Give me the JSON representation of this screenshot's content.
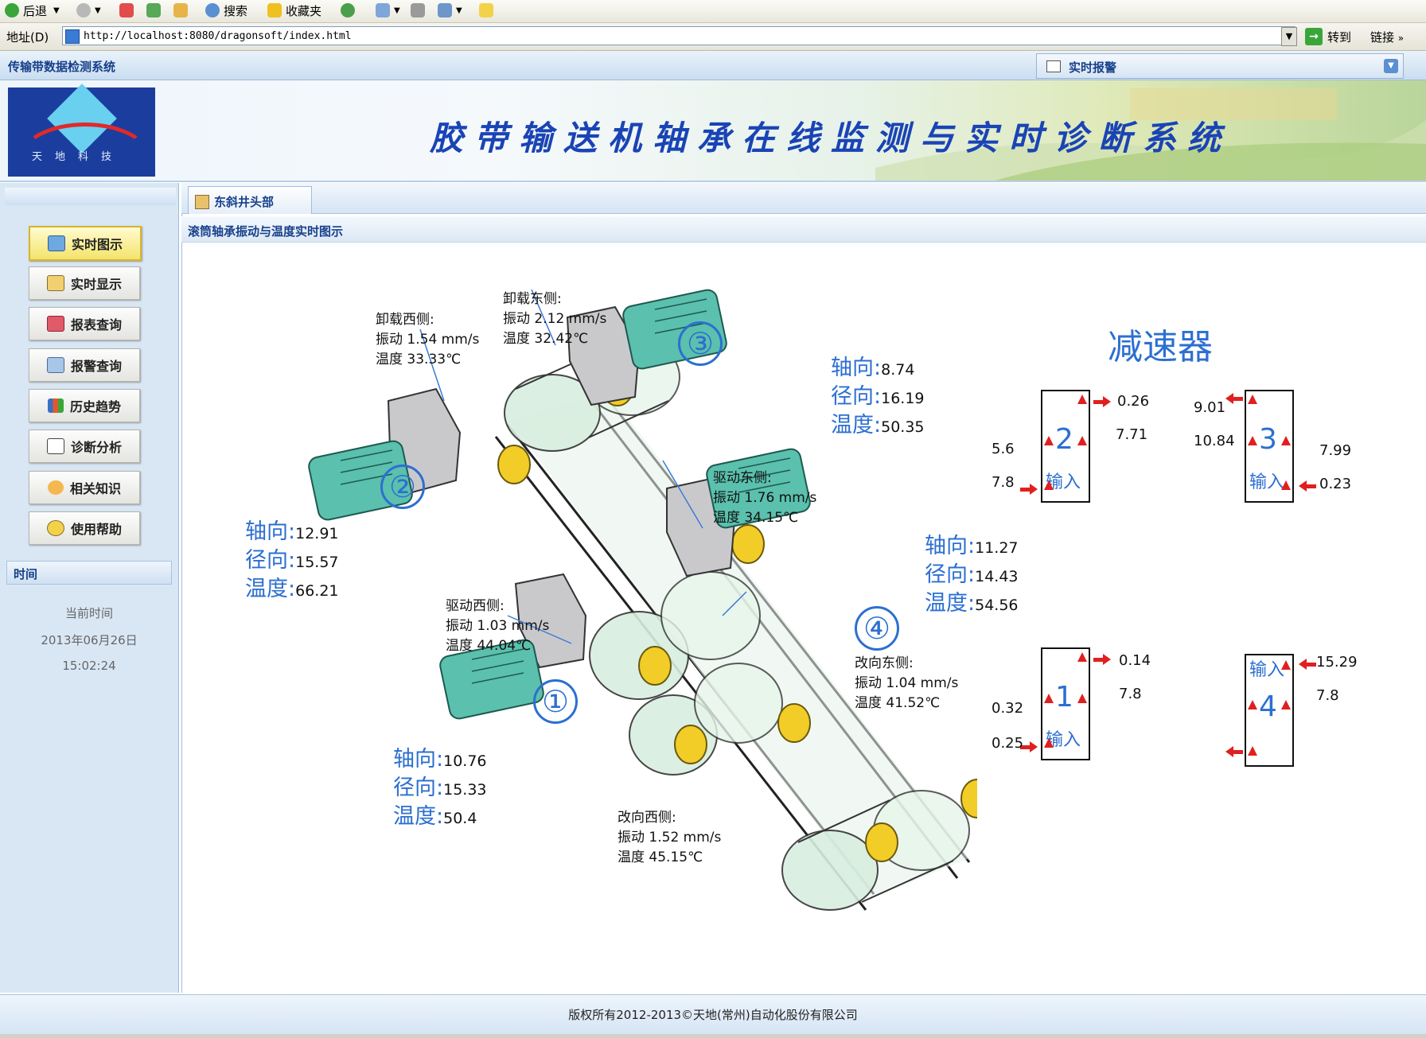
{
  "browser": {
    "back_label": "后退",
    "search_label": "搜索",
    "favorites_label": "收藏夹",
    "address_label": "地址(D)",
    "url": "http://localhost:8080/dragonsoft/index.html",
    "go_label": "转到",
    "links_label": "链接"
  },
  "app": {
    "title": "传输带数据检测系统",
    "alarm_label": "实时报警",
    "logo_text": "天地科技",
    "banner_title": "胶带输送机轴承在线监测与实时诊断系统"
  },
  "sidebar": {
    "items": [
      {
        "label": "实时图示",
        "icon": "monitor-icon",
        "active": true
      },
      {
        "label": "实时显示",
        "icon": "edit-icon",
        "active": false
      },
      {
        "label": "报表查询",
        "icon": "report-icon",
        "active": false
      },
      {
        "label": "报警查询",
        "icon": "alarm-list-icon",
        "active": false
      },
      {
        "label": "历史趋势",
        "icon": "trend-chart-icon",
        "active": false
      },
      {
        "label": "诊断分析",
        "icon": "diagnosis-icon",
        "active": false
      },
      {
        "label": "相关知识",
        "icon": "knowledge-icon",
        "active": false
      },
      {
        "label": "使用帮助",
        "icon": "help-icon",
        "active": false
      }
    ],
    "time_header": "时间",
    "time_caption": "当前时间",
    "date": "2013年06月26日",
    "time": "15:02:24"
  },
  "tab": {
    "label": "东斜井头部"
  },
  "subtitle": "滚筒轴承振动与温度实时图示",
  "bearings": [
    {
      "name": "卸载西侧:",
      "vib": "振动 1.54 mm/s",
      "temp": "温度 33.33℃"
    },
    {
      "name": "卸载东侧:",
      "vib": "振动 2.12 mm/s",
      "temp": "温度 32.42℃"
    },
    {
      "name": "驱动东侧:",
      "vib": "振动 1.76 mm/s",
      "temp": "温度 34.15℃"
    },
    {
      "name": "驱动西侧:",
      "vib": "振动 1.03 mm/s",
      "temp": "温度 44.04℃"
    },
    {
      "name": "改向东侧:",
      "vib": "振动 1.04 mm/s",
      "temp": "温度 41.52℃"
    },
    {
      "name": "改向西侧:",
      "vib": "振动 1.52 mm/s",
      "temp": "温度 45.15℃"
    }
  ],
  "motors": [
    {
      "num": "①",
      "axial_label": "轴向:",
      "axial": "10.76",
      "radial_label": "径向:",
      "radial": "15.33",
      "temp_label": "温度:",
      "temp": "50.4"
    },
    {
      "num": "②",
      "axial_label": "轴向:",
      "axial": "12.91",
      "radial_label": "径向:",
      "radial": "15.57",
      "temp_label": "温度:",
      "temp": "66.21"
    },
    {
      "num": "③",
      "axial_label": "轴向:",
      "axial": "8.74",
      "radial_label": "径向:",
      "radial": "16.19",
      "temp_label": "温度:",
      "temp": "50.35"
    },
    {
      "num": "④",
      "axial_label": "轴向:",
      "axial": "11.27",
      "radial_label": "径向:",
      "radial": "14.43",
      "temp_label": "温度:",
      "temp": "54.56"
    }
  ],
  "reducers": {
    "title": "减速器",
    "input_label": "输入",
    "units": [
      {
        "num": "2",
        "top": "0.26",
        "right": "7.71",
        "left": "5.6",
        "input": "7.8"
      },
      {
        "num": "3",
        "top": "9.01",
        "left2": "10.84",
        "right": "7.99",
        "input": "0.23"
      },
      {
        "num": "1",
        "top": "0.14",
        "right": "7.8",
        "left": "0.32",
        "input": "0.25"
      },
      {
        "num": "4",
        "top": "15.29",
        "right": "7.8"
      }
    ]
  },
  "footer": "版权所有2012-2013©天地(常州)自动化股份有限公司",
  "colors": {
    "accent": "#2c6fd1",
    "nav_title": "#17408b",
    "alarm_red": "#e02020",
    "motor": "#4fb8a4"
  }
}
